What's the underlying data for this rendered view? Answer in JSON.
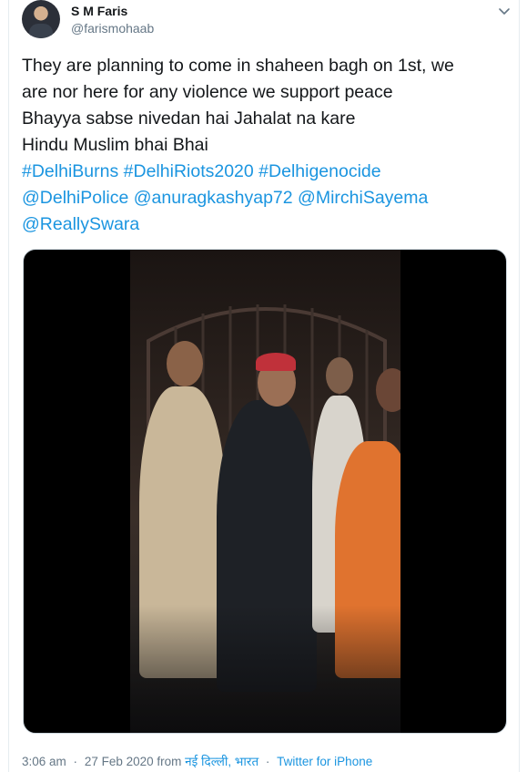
{
  "author": {
    "display_name": "S M Faris",
    "handle": "@farismohaab"
  },
  "tweet": {
    "lines": [
      "They are planning to come in shaheen bagh on 1st, we",
      "are nor here for any violence we support peace",
      "Bhayya sabse nivedan hai Jahalat na kare",
      "Hindu Muslim bhai Bhai"
    ],
    "hashtags": [
      "#DelhiBurns",
      "#DelhiRiots2020",
      "#Delhigenocide"
    ],
    "mentions": [
      "@DelhiPolice",
      "@anuragkashyap72",
      "@MirchiSayema",
      "@ReallySwara"
    ]
  },
  "meta": {
    "time": "3:06 am",
    "date": "27 Feb 2020",
    "from_label": "from",
    "location": "नई दिल्ली, भारत",
    "source": "Twitter for iPhone",
    "separator": "·"
  },
  "icons": {
    "menu": "chevron-down-icon",
    "avatar": "profile-avatar"
  },
  "colors": {
    "link": "#1b95e0",
    "secondary_text": "#657786",
    "primary_text": "#14171a"
  }
}
